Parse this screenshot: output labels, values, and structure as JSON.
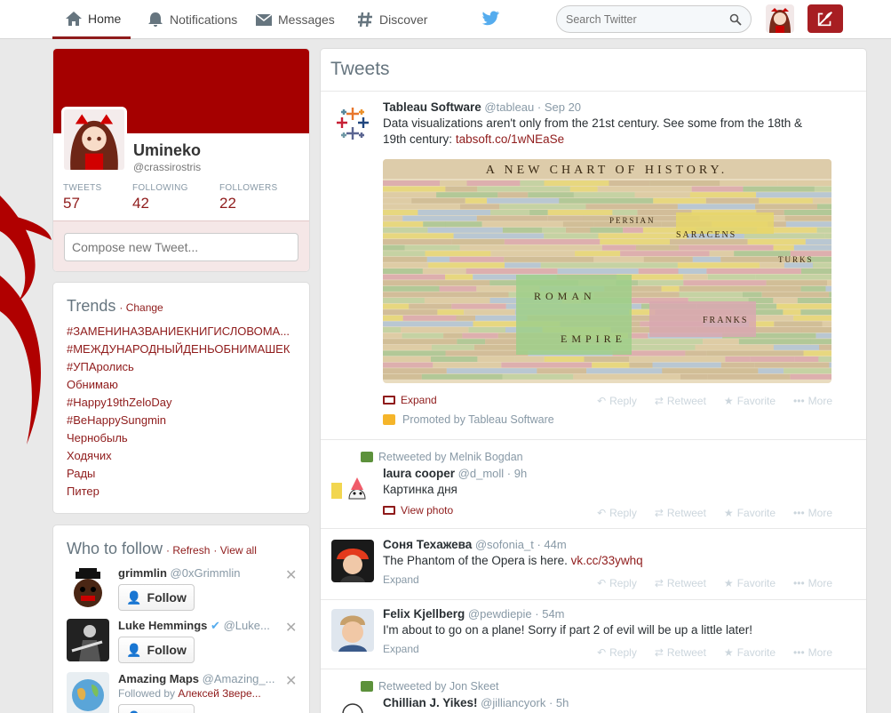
{
  "nav": {
    "home": "Home",
    "notifications": "Notifications",
    "messages": "Messages",
    "discover": "Discover",
    "search_placeholder": "Search Twitter"
  },
  "profile": {
    "name": "Umineko",
    "handle": "@crassirostris",
    "tweets_label": "TWEETS",
    "tweets_count": "57",
    "following_label": "FOLLOWING",
    "following_count": "42",
    "followers_label": "FOLLOWERS",
    "followers_count": "22",
    "compose_placeholder": "Compose new Tweet..."
  },
  "trends": {
    "title": "Trends",
    "change": "· Change",
    "items": [
      "#ЗАМЕНИНАЗВАНИЕКНИГИСЛОВОМА...",
      "#МЕЖДУНАРОДНЫЙДЕНЬОБНИМАШЕК",
      "#УПАролись",
      "Обнимаю",
      "#Happy19thZeloDay",
      "#BeHappySungmin",
      "Чернобыль",
      "Ходячих",
      "Рады",
      "Питер"
    ]
  },
  "who_to_follow": {
    "title": "Who to follow",
    "refresh": "· Refresh",
    "view_all": "· View all",
    "follow_label": "Follow",
    "users": [
      {
        "name": "grimmlin",
        "handle": "@0xGrimmlin",
        "sub": ""
      },
      {
        "name": "Luke Hemmings",
        "handle": "@Luke...",
        "sub": ""
      },
      {
        "name": "Amazing Maps",
        "handle": "@Amazing_...",
        "sub_prefix": "Followed by",
        "sub": "Алексей Звере..."
      }
    ]
  },
  "timeline": {
    "title": "Tweets",
    "actions": {
      "reply": "Reply",
      "retweet": "Retweet",
      "favorite": "Favorite",
      "more": "More"
    },
    "tweets": [
      {
        "name": "Tableau Software",
        "handle": "@tableau",
        "time": "· Sep 20",
        "text": "Data visualizations aren't only from the 21st century. See some from the 18th & 19th century:",
        "link": "tabsoft.co/1wNEaSe",
        "expand": "Expand",
        "promoted": "Promoted by Tableau Software",
        "image_title": "A NEW CHART OF HISTORY.",
        "image_words": [
          "ROMAN",
          "EMPIRE",
          "SARACENS",
          "PERSIAN",
          "FRANKS",
          "TURKS",
          "EMPIRE"
        ]
      },
      {
        "retweeted_by": "Retweeted by Melnik Bogdan",
        "name": "laura cooper",
        "handle": "@d_moll",
        "time": "· 9h",
        "text": "Картинка дня",
        "view_photo": "View photo"
      },
      {
        "name": "Соня Техажева",
        "handle": "@sofonia_t",
        "time": "· 44m",
        "text": "The Phantom of the Opera is here.",
        "link": "vk.cc/33ywhq",
        "expand": "Expand"
      },
      {
        "name": "Felix Kjellberg",
        "handle": "@pewdiepie",
        "time": "· 54m",
        "text": "I'm about to go on a plane! Sorry if part 2 of evil will be up a little later!",
        "expand": "Expand"
      },
      {
        "retweeted_by": "Retweeted by Jon Skeet",
        "name": "Chillian J. Yikes!",
        "handle": "@jilliancyork",
        "time": "· 5h"
      }
    ]
  },
  "colors": {
    "accent": "#8f1b1b",
    "banner": "#a50000",
    "tweet_button": "#a71e22",
    "twitter_bird": "#55acee"
  }
}
